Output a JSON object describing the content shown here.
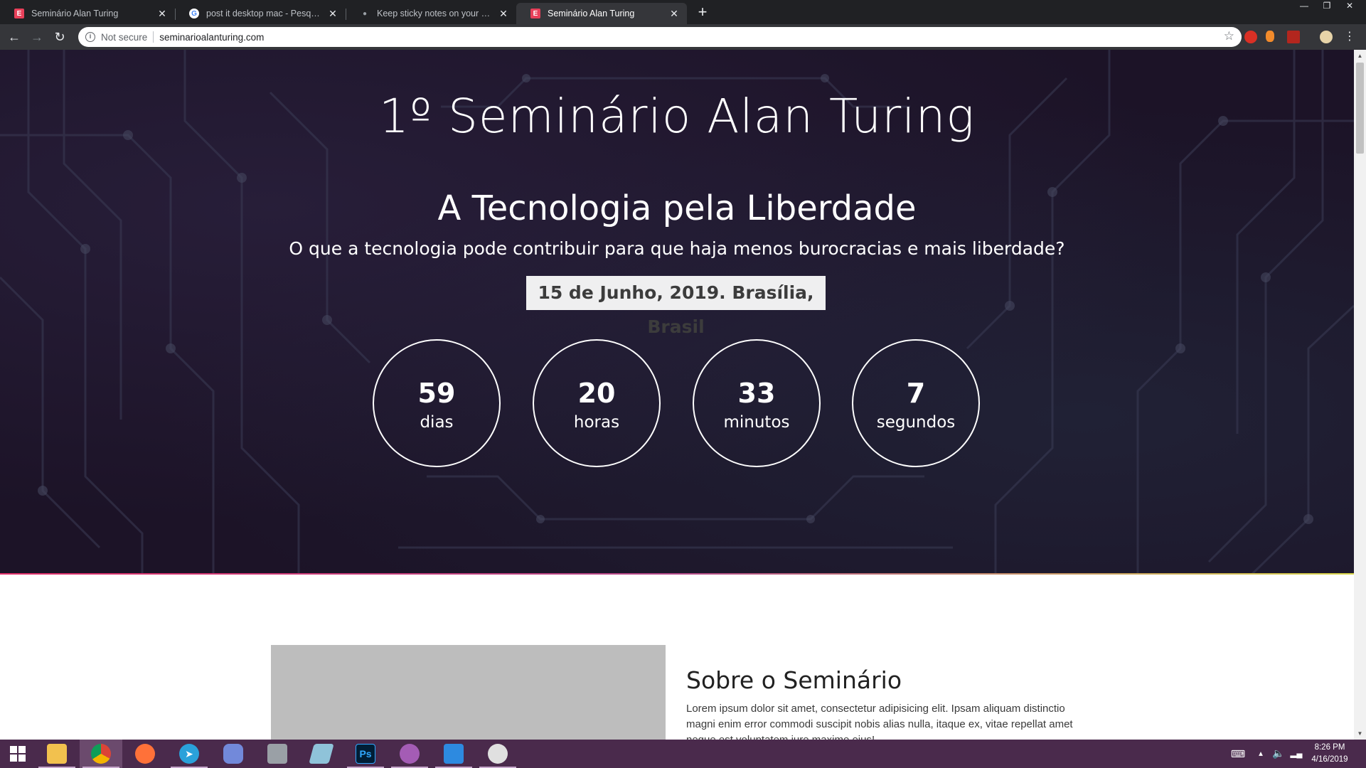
{
  "browser": {
    "tabs": [
      {
        "title": "Seminário Alan Turing",
        "favicon": "e-logo-icon",
        "active": false
      },
      {
        "title": "post it desktop mac - Pesquisa Goo",
        "favicon": "google-icon",
        "active": false
      },
      {
        "title": "Keep sticky notes on your Mac des",
        "favicon": "apple-icon",
        "active": false
      },
      {
        "title": "Seminário Alan Turing",
        "favicon": "e-logo-icon",
        "active": true
      }
    ],
    "security_label": "Not secure",
    "url": "seminarioalanturing.com"
  },
  "hero": {
    "title": "1º Seminário Alan Turing",
    "subtitle": "A Tecnologia pela Liberdade",
    "question": "O que a tecnologia pode contribuir para que haja menos burocracias e mais liberdade?",
    "date": "15 de Junho, 2019. Brasília, Brasil",
    "countdown": [
      {
        "value": "59",
        "unit": "dias"
      },
      {
        "value": "20",
        "unit": "horas"
      },
      {
        "value": "33",
        "unit": "minutos"
      },
      {
        "value": "7",
        "unit": "segundos"
      }
    ]
  },
  "about": {
    "title": "Sobre o Seminário",
    "text": "Lorem ipsum dolor sit amet, consectetur adipisicing elit. Ipsam aliquam distinctio magni enim error commodi suscipit nobis alias nulla, itaque ex, vitae repellat amet neque est voluptatem iure maxime eius!"
  },
  "taskbar": {
    "apps": [
      {
        "name": "start-button",
        "label": "",
        "color": "#ffffff"
      },
      {
        "name": "file-explorer",
        "label": "",
        "color": "#f2c14e"
      },
      {
        "name": "chrome",
        "label": "",
        "color": "#4285f4"
      },
      {
        "name": "firefox",
        "label": "",
        "color": "#ff7139"
      },
      {
        "name": "telegram",
        "label": "",
        "color": "#2aa1da"
      },
      {
        "name": "discord",
        "label": "",
        "color": "#7289da"
      },
      {
        "name": "calculator",
        "label": "",
        "color": "#9aa0a6"
      },
      {
        "name": "notes",
        "label": "",
        "color": "#8fc3d9"
      },
      {
        "name": "photoshop",
        "label": "Ps",
        "color": "#31a8ff"
      },
      {
        "name": "gitkraken",
        "label": "",
        "color": "#a45cb5"
      },
      {
        "name": "vscode",
        "label": "",
        "color": "#2d8ae0"
      },
      {
        "name": "paint",
        "label": "",
        "color": "#e0e0e0"
      }
    ],
    "time": "8:26 PM",
    "date": "4/16/2019"
  }
}
